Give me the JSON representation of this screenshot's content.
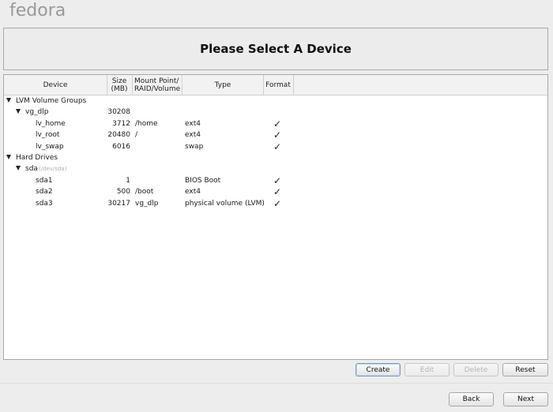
{
  "app": {
    "logo_text": "fedora"
  },
  "title": "Please Select A Device",
  "columns": {
    "device": "Device",
    "size": "Size\n(MB)",
    "mount": "Mount Point/\nRAID/Volume",
    "type": "Type",
    "format": "Format"
  },
  "rows": [
    {
      "level": 0,
      "expander": true,
      "device": "LVM Volume Groups",
      "hint": "",
      "size": "",
      "mount": "",
      "type": "",
      "format": false
    },
    {
      "level": 1,
      "expander": true,
      "device": "vg_dlp",
      "hint": "",
      "size": "30208",
      "mount": "",
      "type": "",
      "format": false
    },
    {
      "level": 2,
      "expander": false,
      "device": "lv_home",
      "hint": "",
      "size": "3712",
      "mount": "/home",
      "type": "ext4",
      "format": true
    },
    {
      "level": 2,
      "expander": false,
      "device": "lv_root",
      "hint": "",
      "size": "20480",
      "mount": "/",
      "type": "ext4",
      "format": true
    },
    {
      "level": 2,
      "expander": false,
      "device": "lv_swap",
      "hint": "",
      "size": "6016",
      "mount": "",
      "type": "swap",
      "format": true
    },
    {
      "level": 0,
      "expander": true,
      "device": "Hard Drives",
      "hint": "",
      "size": "",
      "mount": "",
      "type": "",
      "format": false
    },
    {
      "level": 1,
      "expander": true,
      "device": "sda",
      "hint": "(/dev/sda)",
      "size": "",
      "mount": "",
      "type": "",
      "format": false
    },
    {
      "level": 2,
      "expander": false,
      "device": "sda1",
      "hint": "",
      "size": "1",
      "mount": "",
      "type": "BIOS Boot",
      "format": true
    },
    {
      "level": 2,
      "expander": false,
      "device": "sda2",
      "hint": "",
      "size": "500",
      "mount": "/boot",
      "type": "ext4",
      "format": true
    },
    {
      "level": 2,
      "expander": false,
      "device": "sda3",
      "hint": "",
      "size": "30217",
      "mount": "vg_dlp",
      "type": "physical volume (LVM)",
      "format": true
    }
  ],
  "format_check_glyph": "✓",
  "actions": {
    "create": "Create",
    "edit": "Edit",
    "delete": "Delete",
    "reset": "Reset",
    "edit_enabled": false,
    "delete_enabled": false
  },
  "nav": {
    "back": "Back",
    "next": "Next"
  }
}
